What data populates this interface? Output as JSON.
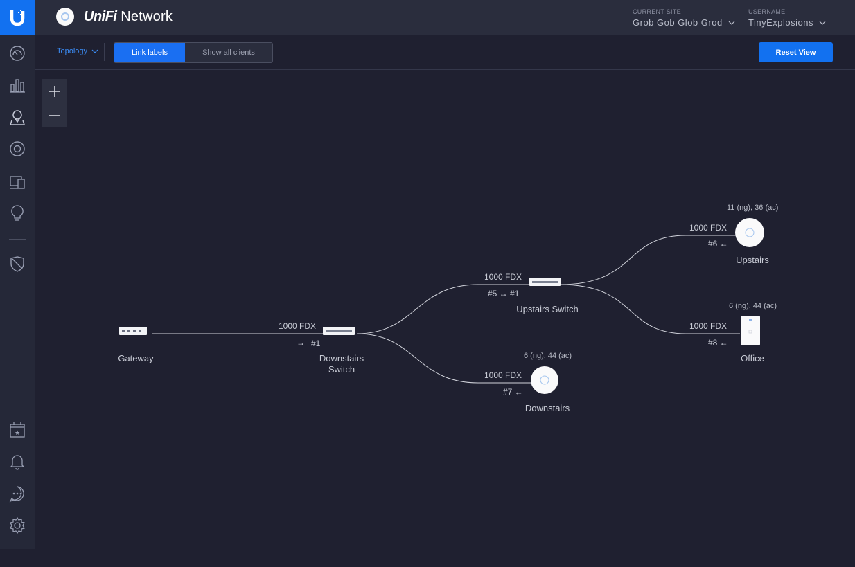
{
  "app": {
    "brand": "UniFi",
    "name": "Network"
  },
  "header": {
    "site_label": "CURRENT SITE",
    "site_value": "Grob Gob Glob Grod",
    "user_label": "USERNAME",
    "user_value": "TinyExplosions"
  },
  "toolbar": {
    "view_select": "Topology",
    "link_labels": "Link labels",
    "show_all_clients": "Show all clients",
    "reset_view": "Reset View"
  },
  "sidebar": {
    "items": [
      {
        "icon": "dashboard-icon"
      },
      {
        "icon": "statistics-icon"
      },
      {
        "icon": "map-icon"
      },
      {
        "icon": "devices-icon"
      },
      {
        "icon": "clients-icon"
      },
      {
        "icon": "insights-icon"
      },
      {
        "icon": "shield-icon"
      },
      {
        "icon": "events-icon"
      },
      {
        "icon": "alerts-icon"
      },
      {
        "icon": "chat-icon"
      },
      {
        "icon": "settings-icon"
      }
    ]
  },
  "topology": {
    "gateway": {
      "name": "Gateway"
    },
    "downstairs_switch": {
      "name_line1": "Downstairs",
      "name_line2": "Switch",
      "uplink_speed": "1000  FDX",
      "uplink_port": "#1",
      "uplink_arrow": "→"
    },
    "upstairs_switch": {
      "name": "Upstairs Switch",
      "uplink_speed": "1000  FDX",
      "uplink_ports": "#5 ↔ #1"
    },
    "downstairs_ap": {
      "name": "Downstairs",
      "channels": "6 (ng), 44 (ac)",
      "uplink_speed": "1000  FDX",
      "uplink_port": "#7 ←"
    },
    "upstairs_ap": {
      "name": "Upstairs",
      "channels": "11 (ng), 36 (ac)",
      "uplink_speed": "1000  FDX",
      "uplink_port": "#6 ←"
    },
    "office_ap": {
      "name": "Office",
      "channels": "6 (ng), 44 (ac)",
      "uplink_speed": "1000  FDX",
      "uplink_port": "#8 ←"
    }
  },
  "colors": {
    "accent": "#1271f0",
    "background": "#1f2030",
    "sidebar": "#252838",
    "link_line": "#d0d2da"
  }
}
